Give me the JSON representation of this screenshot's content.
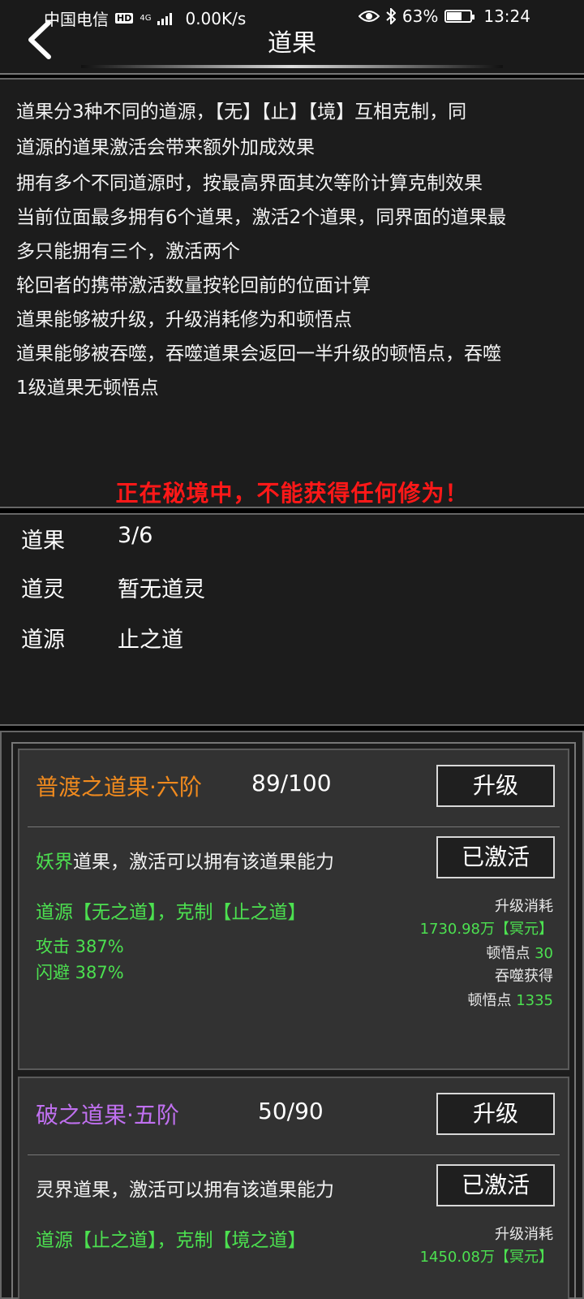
{
  "status": {
    "carrier": "中国电信",
    "hd": "HD",
    "net": "4G",
    "speed": "0.00K/s",
    "battery": "63%",
    "battery_level": 0.63,
    "time": "13:24"
  },
  "header": {
    "title": "道果"
  },
  "info": {
    "lines": [
      "道果分3种不同的道源，【无】【止】【境】互相克制，同",
      "道源的道果激活会带来额外加成效果",
      "拥有多个不同道源时，按最高界面其次等阶计算克制效果",
      "当前位面最多拥有6个道果，激活2个道果，同界面的道果最",
      "多只能拥有三个，激活两个",
      "轮回者的携带激活数量按轮回前的位面计算",
      "道果能够被升级，升级消耗修为和顿悟点",
      "道果能够被吞噬，吞噬道果会返回一半升级的顿悟点，吞噬",
      "1级道果无顿悟点"
    ],
    "warning": "正在秘境中，不能获得任何修为！"
  },
  "stats": [
    {
      "label": "道果",
      "value": "3/6"
    },
    {
      "label": "道灵",
      "value": "暂无道灵"
    },
    {
      "label": "道源",
      "value": "止之道"
    }
  ],
  "cards": [
    {
      "name": "普渡之道果·六阶",
      "name_color": "#f08a1e",
      "progress": "89/100",
      "upgrade_label": "升级",
      "realm_highlight": "妖界",
      "realm_text": "道果，激活可以拥有该道果能力",
      "activated_label": "已激活",
      "source": "道源【无之道】，克制【止之道】",
      "stats": [
        "攻击 387%",
        "闪避 387%"
      ],
      "cost_title": "升级消耗",
      "cost_value": "1730.98万【冥元】",
      "insight_label": "顿悟点",
      "insight_value": "30",
      "devour_title": "吞噬获得",
      "devour_label": "顿悟点",
      "devour_value": "1335"
    },
    {
      "name": "破之道果·五阶",
      "name_color": "#c070f0",
      "progress": "50/90",
      "upgrade_label": "升级",
      "realm_highlight": "",
      "realm_text": "灵界道果，激活可以拥有该道果能力",
      "activated_label": "已激活",
      "source": "道源【止之道】，克制【境之道】",
      "cost_title": "升级消耗",
      "cost_value": "1450.08万【冥元】"
    }
  ]
}
